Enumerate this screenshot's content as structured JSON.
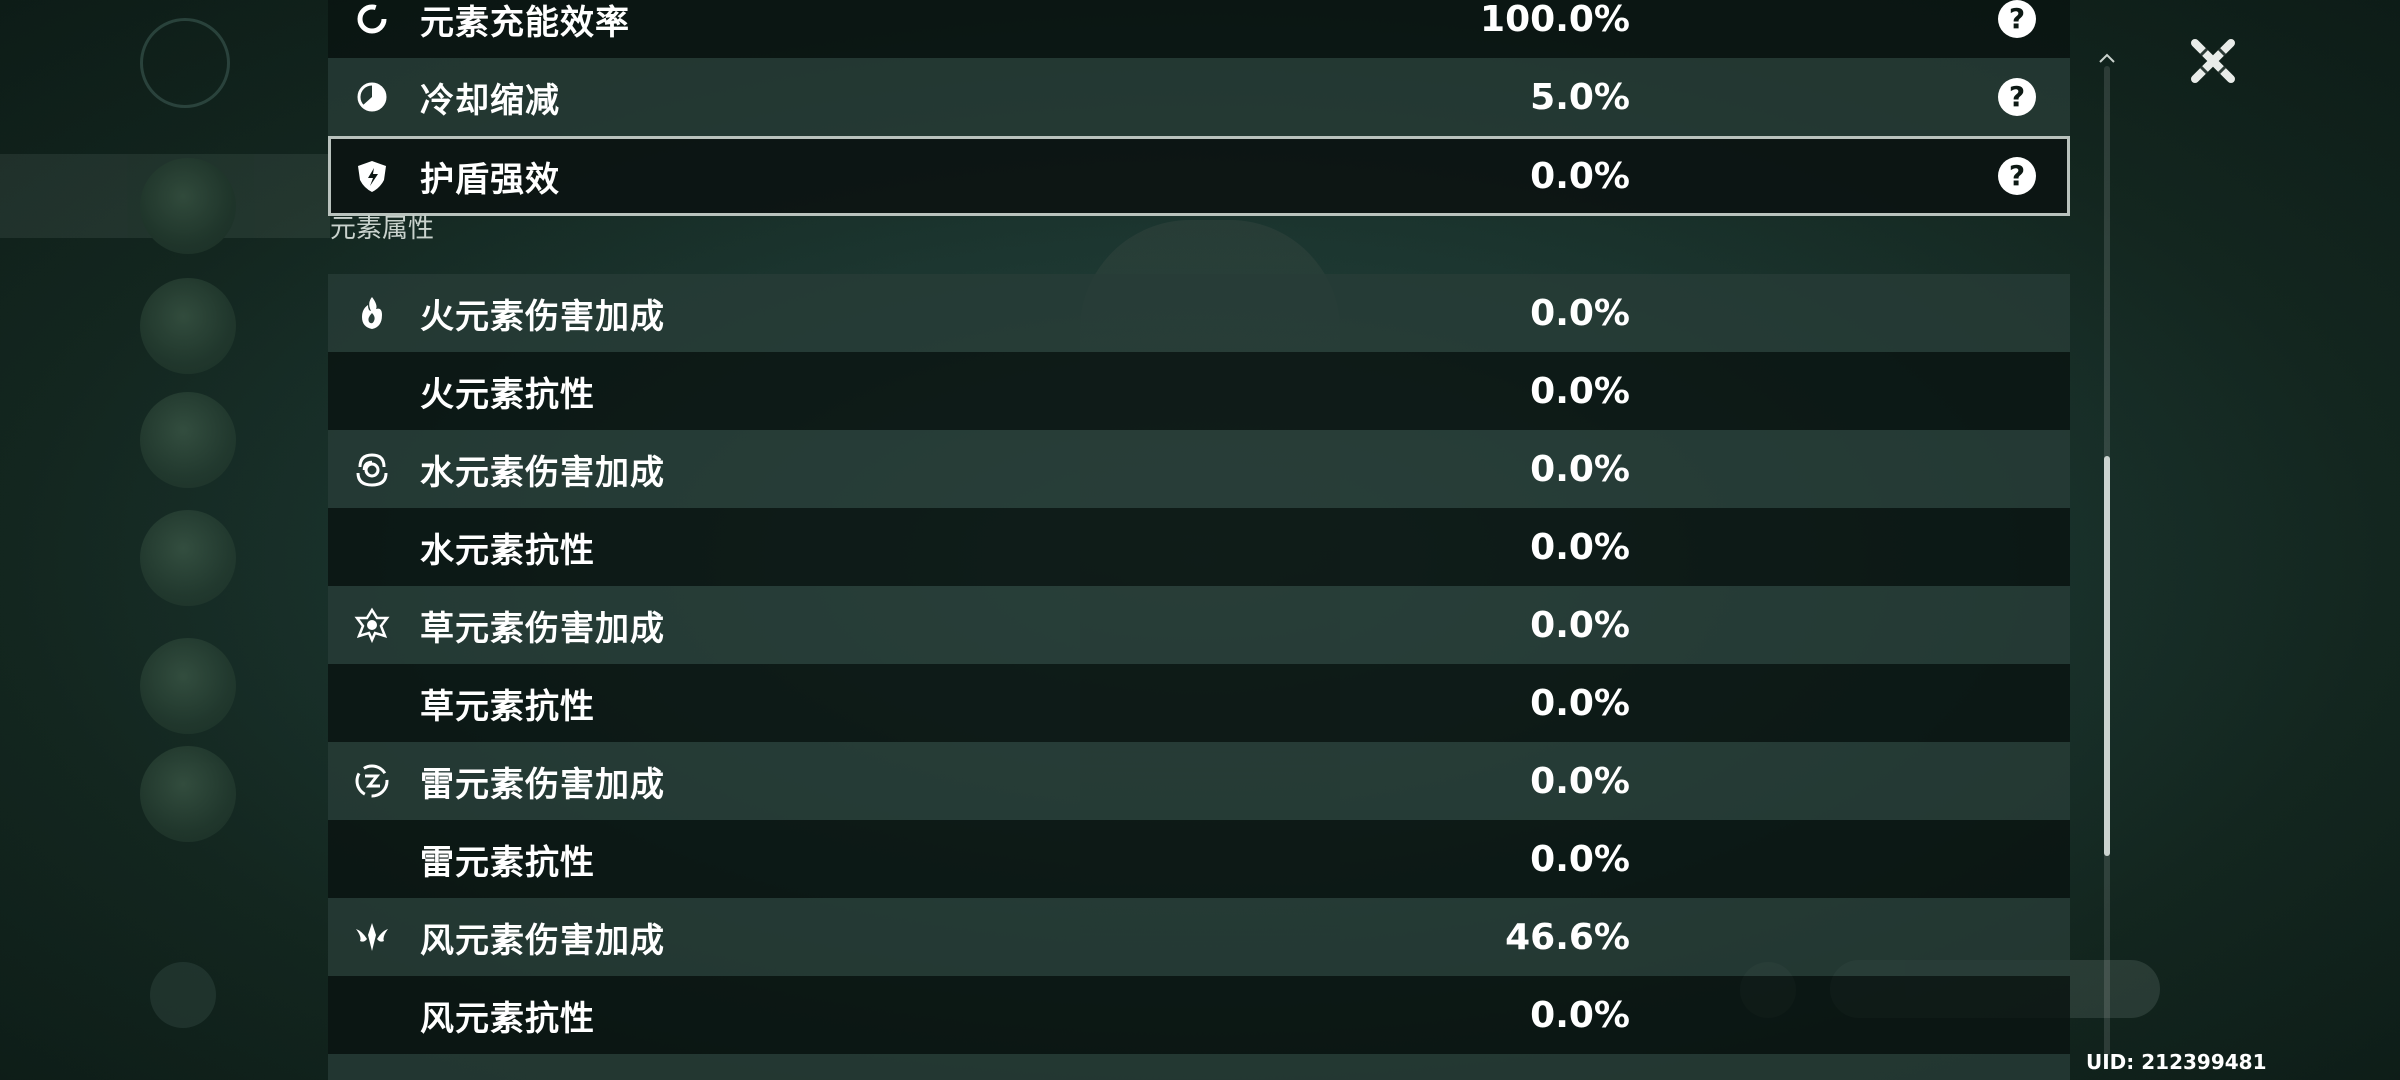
{
  "stats": {
    "top_rows": [
      {
        "icon": "energy-recharge-icon",
        "label": "元素充能效率",
        "value": "100.0%"
      },
      {
        "icon": "cd-reduction-icon",
        "label": "冷却缩减",
        "value": "5.0%"
      },
      {
        "icon": "shield-icon",
        "label": "护盾强效",
        "value": "0.0%"
      }
    ],
    "section_title": "元素属性",
    "element_rows": [
      {
        "icon": "pyro-icon",
        "label": "火元素伤害加成",
        "value": "0.0%"
      },
      {
        "icon": "",
        "label": "火元素抗性",
        "value": "0.0%"
      },
      {
        "icon": "hydro-icon",
        "label": "水元素伤害加成",
        "value": "0.0%"
      },
      {
        "icon": "",
        "label": "水元素抗性",
        "value": "0.0%"
      },
      {
        "icon": "dendro-icon",
        "label": "草元素伤害加成",
        "value": "0.0%"
      },
      {
        "icon": "",
        "label": "草元素抗性",
        "value": "0.0%"
      },
      {
        "icon": "electro-icon",
        "label": "雷元素伤害加成",
        "value": "0.0%"
      },
      {
        "icon": "",
        "label": "雷元素抗性",
        "value": "0.0%"
      },
      {
        "icon": "anemo-icon",
        "label": "风元素伤害加成",
        "value": "46.6%"
      },
      {
        "icon": "",
        "label": "风元素抗性",
        "value": "0.0%"
      }
    ],
    "help_glyph": "?"
  },
  "uid": "UID: 212399481",
  "scroll": {
    "position_fraction": 0.45
  },
  "colors": {
    "row_light": "#2a3f3a",
    "row_dark": "#0c1613",
    "selected_border": "#b9c2bd",
    "text": "#ffffff"
  }
}
